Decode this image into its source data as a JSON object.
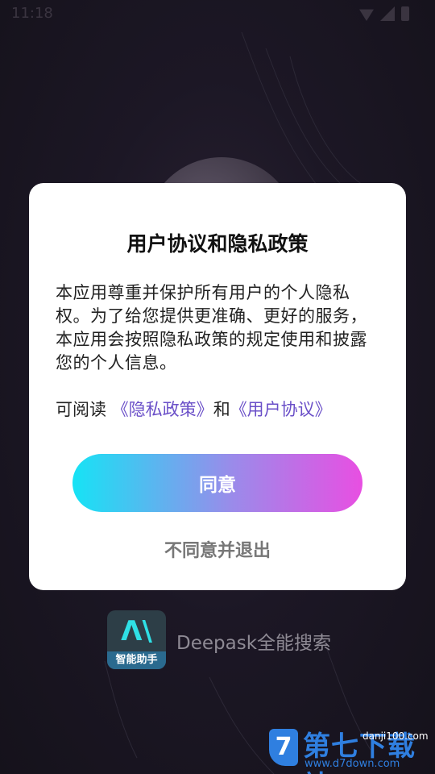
{
  "status_bar": {
    "time": "11:18",
    "icons": [
      "wifi-icon",
      "signal-icon",
      "battery-icon"
    ]
  },
  "dialog": {
    "title": "用户协议和隐私政策",
    "body": "本应用尊重并保护所有用户的个人隐私权。为了给您提供更准确、更好的服务，本应用会按照隐私政策的规定使用和披露您的个人信息。",
    "read_prefix": "可阅读",
    "privacy_link": "《隐私政策》",
    "and_text": "和",
    "agreement_link": "《用户协议》",
    "agree_label": "同意",
    "decline_label": "不同意并退出"
  },
  "app": {
    "logo_label": "智能助手",
    "name": "Deepask全能搜索"
  },
  "watermark": {
    "title": "第七下载站",
    "subtitle": "danji100.com",
    "url": "www.d7down.com"
  },
  "colors": {
    "link": "#6a4fc8",
    "button_gradient_start": "#16e3f5",
    "button_gradient_end": "#e84fe2",
    "watermark_blue": "#2f7fe0"
  }
}
